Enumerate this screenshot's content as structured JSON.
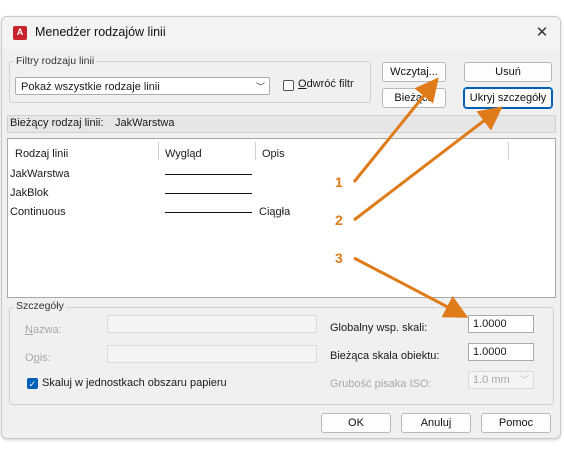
{
  "window": {
    "title": "Menedżer rodzajów linii",
    "icon_letter": "A"
  },
  "filters": {
    "group_label": "Filtry rodzaju linii",
    "selected": "Pokaż wszystkie rodzaje linii",
    "invert_label": "Odwróć filtr",
    "invert_checked": false
  },
  "buttons": {
    "load": "Wczytaj...",
    "delete": "Usuń",
    "current": "Bieżąca",
    "hide_details": "Ukryj szczegóły",
    "ok": "OK",
    "cancel": "Anuluj",
    "help": "Pomoc"
  },
  "current_linetype": {
    "label": "Bieżący rodzaj linii:",
    "value": "JakWarstwa"
  },
  "table": {
    "headers": [
      "Rodzaj linii",
      "Wygląd",
      "Opis"
    ],
    "rows": [
      {
        "name": "JakWarstwa",
        "description": ""
      },
      {
        "name": "JakBlok",
        "description": ""
      },
      {
        "name": "Continuous",
        "description": "Ciągła"
      }
    ]
  },
  "details": {
    "group_label": "Szczegóły",
    "name_label": "Nazwa:",
    "desc_label": "Opis:",
    "paper_units_label": "Skaluj w jednostkach obszaru papieru",
    "paper_units_checked": true,
    "global_scale_label": "Globalny wsp. skali:",
    "global_scale_value": "1.0000",
    "object_scale_label": "Bieżąca skala obiektu:",
    "object_scale_value": "1.0000",
    "pen_width_label": "Grubość pisaka ISO:",
    "pen_width_value": "1.0 mm"
  },
  "callouts": [
    "1",
    "2",
    "3"
  ],
  "colors": {
    "accent": "#005fb8",
    "callout": "#e07b1a",
    "app_icon": "#c8222a"
  }
}
